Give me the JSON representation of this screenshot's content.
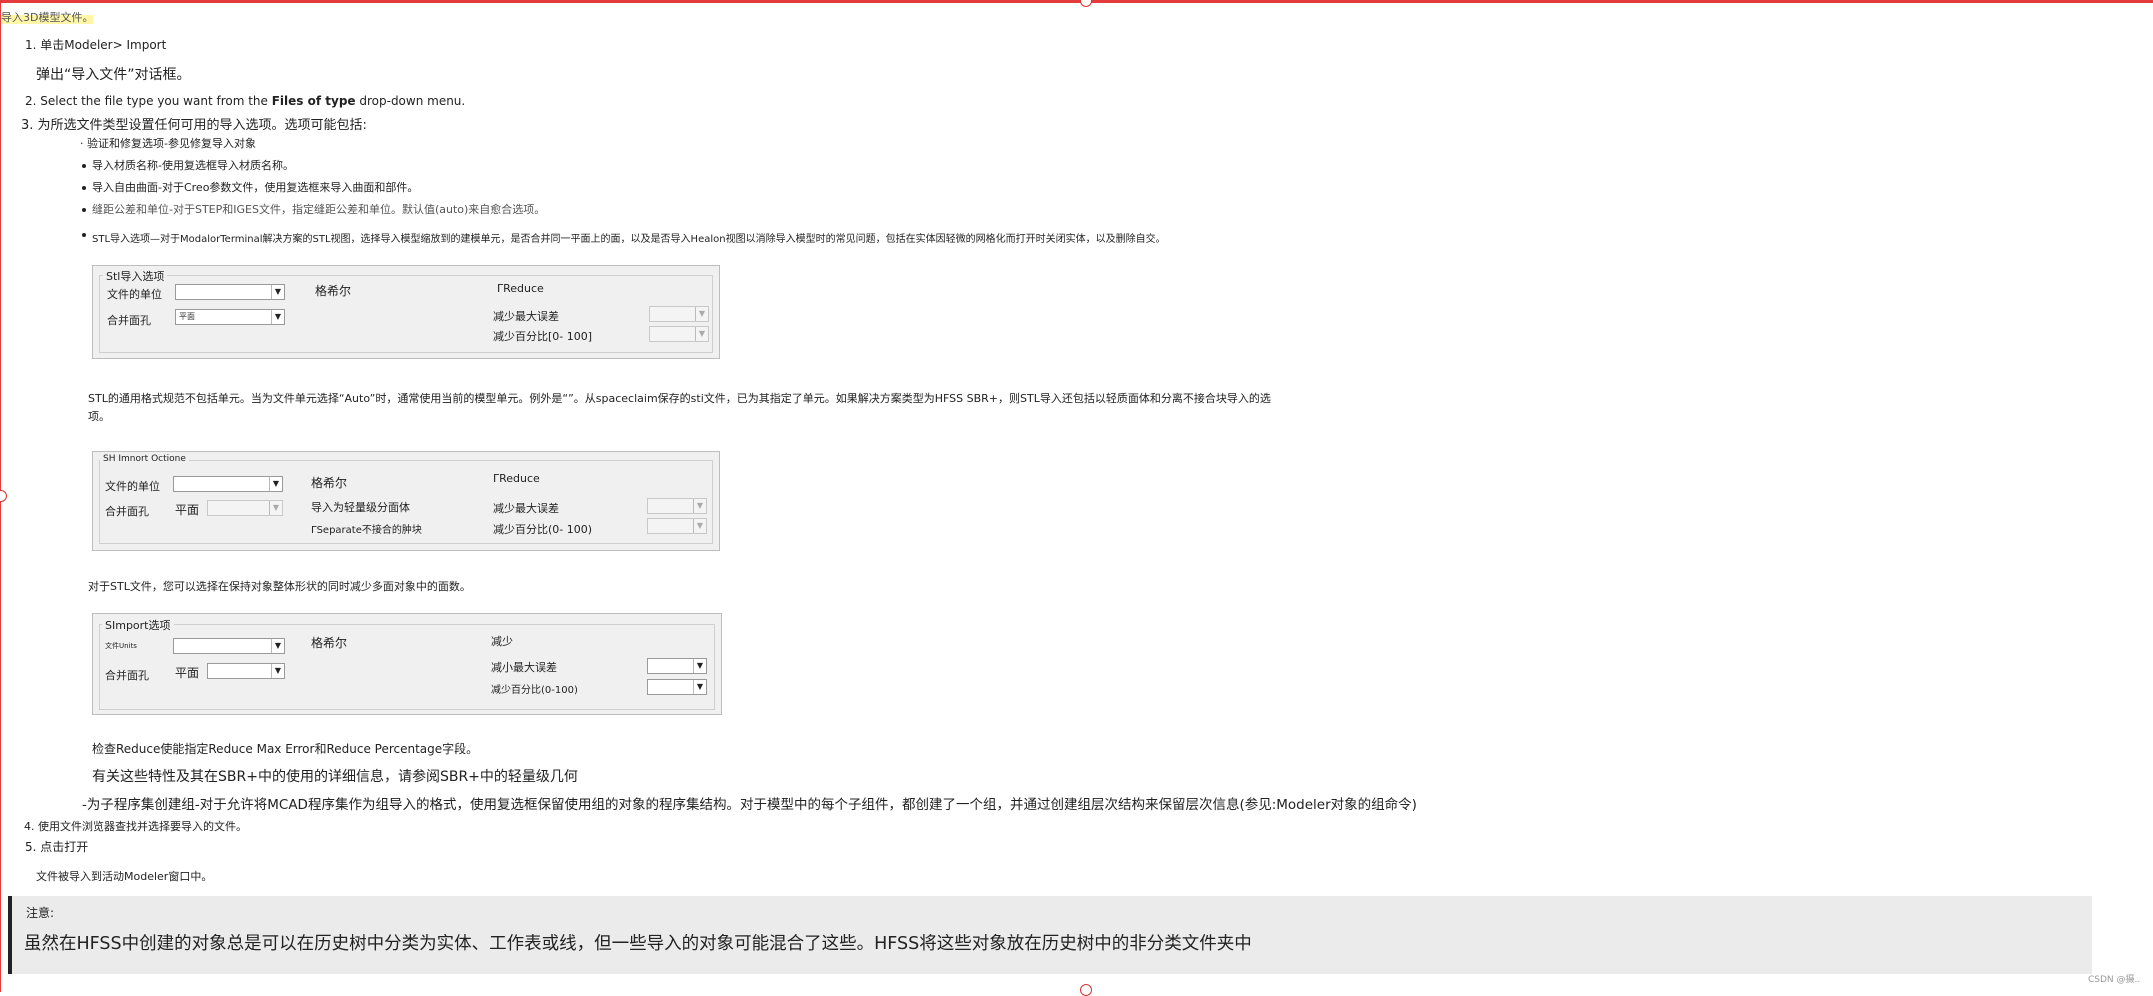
{
  "header": {
    "intro": "导入3D模型文件。"
  },
  "steps": {
    "s1": "1. 单击Modeler> Import",
    "s1_sub": "弹出“导入文件”对话框。",
    "s2_pre": "2. Select the file type you want from the ",
    "s2_bold": "Files of type",
    "s2_post": " drop-down menu.",
    "s3": "3. 为所选文件类型设置任何可用的导入选项。选项可能包括:",
    "s4": "4. 使用文件浏览器查找并选择要导入的文件。",
    "s5": "5. 点击打开",
    "s5_sub": "文件被导入到活动Modeler窗口中。"
  },
  "options": [
    "验证和修复选项-参见修复导入对象",
    "导入材质名称-使用复选框导入材质名称。",
    "导入自由曲面-对于Creo参数文件，使用复选框来导入曲面和部件。",
    "缝距公差和单位-对于STEP和IGES文件，指定缝距公差和单位。默认值(auto)来自愈合选项。",
    "STL导入选项—对于ModalorTerminal解决方案的STL视图，选择导入模型缩放到的建模单元，是否合并同一平面上的面，以及是否导入Healon视图以消除导入模型时的常见问题，包括在实体因轻微的网格化而打开时关闭实体，以及删除自交。"
  ],
  "panel1": {
    "legend": "Stl导入选项",
    "units_label": "文件的单位",
    "merge_label": "合并面孔",
    "merge_value": "平面",
    "heal_label": "格希尔",
    "reduce_label": "ΓReduce",
    "max_error_label": "减少最大误差",
    "percent_label": "减少百分比[0- 100]"
  },
  "para1_line1": "STL的通用格式规范不包括单元。当为文件单元选择“Auto”时，通常使用当前的模型单元。例外是“”。从spaceclaim保存的sti文件，已为其指定了单元。如果解决方案类型为HFSS SBR+，则STL导入还包括以轻质面体和分离不接合块导入的选",
  "para1_line2": "项。",
  "panel2": {
    "legend": "SH Imnort Octione",
    "units_label": "文件的单位",
    "merge_label": "合并面孔",
    "merge_value": "平面",
    "heal_label": "格希尔",
    "lightweight_label": "导入为轻量级分面体",
    "separate_label": "ΓSeparate不接合的肿块",
    "reduce_label": "ΓReduce",
    "max_error_label": "减少最大误差",
    "percent_label": "减少百分比(0- 100)"
  },
  "para2": "对于STL文件，您可以选择在保持对象整体形状的同时减少多面对象中的面数。",
  "panel3": {
    "legend": "SImport选项",
    "units_label": "文件Units",
    "merge_label": "合并面孔",
    "merge_value": "平面",
    "heal_label": "格希尔",
    "reduce_label": "减少",
    "max_error_label": "减小最大误差",
    "percent_label": "减少百分比(0-100)"
  },
  "para3": "检查Reduce使能指定Reduce Max Error和Reduce Percentage字段。",
  "para4": "有关这些特性及其在SBR+中的使用的详细信息，请参阅SBR+中的轻量级几何",
  "para5": "-为子程序集创建组-对于允许将MCAD程序集作为组导入的格式，使用复选框保留使用组的对象的程序集结构。对于模型中的每个子组件，都创建了一个组，并通过创建组层次结构来保留层次信息(参见:Modeler对象的组命令)",
  "note": {
    "label": "注意:",
    "text": "虽然在HFSS中创建的对象总是可以在历史树中分类为实体、工作表或线，但一些导入的对象可能混合了这些。HFSS将这些对象放在历史树中的非分类文件夹中"
  },
  "watermark": "CSDN @摄..",
  "colors": {
    "frame": "#e33b3b",
    "highlight": "#fff6a8",
    "panel_bg": "#f0f0f0",
    "note_bg": "#ebebeb"
  }
}
